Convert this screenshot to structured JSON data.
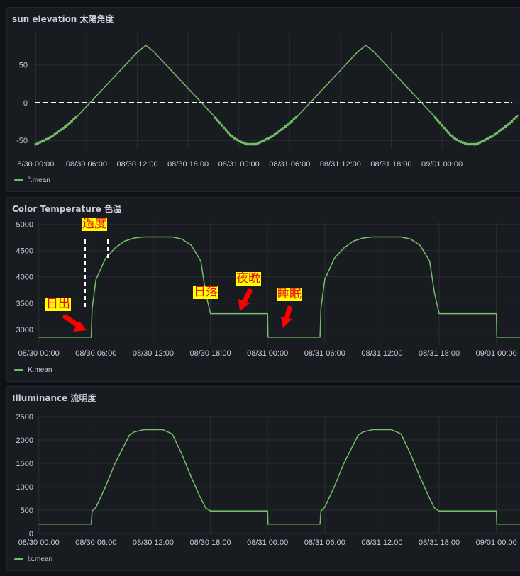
{
  "colors": {
    "line": "#73bf69",
    "grid": "#2a2d33",
    "text": "#ccccdc",
    "annotation_bg": "#ffff00",
    "annotation_text": "#e81010",
    "arrow": "#ff0000",
    "reference_line": "#ffffff"
  },
  "panels": {
    "sun": {
      "title": "sun elevation 太陽角度",
      "legend": "°.mean"
    },
    "ct": {
      "title": "Color Temperature 色温",
      "legend": "K.mean"
    },
    "lux": {
      "title": "Illuminance 流明度",
      "legend": "lx.mean"
    }
  },
  "annotations": {
    "transition": "過度",
    "sunrise": "日出",
    "sunset": "日落",
    "evening": "夜晩",
    "sleep": "睡眠"
  },
  "chart_data": [
    {
      "type": "line",
      "title": "sun elevation 太陽角度",
      "xlabel": "",
      "ylabel": "",
      "x_unit": "hours since 08/30 00:00",
      "xlim": [
        -0.2,
        57.3
      ],
      "x_tick_labels": [
        "8/30 00:00",
        "08/30 06:00",
        "08/30 12:00",
        "08/30 18:00",
        "08/31 00:00",
        "08/31 06:00",
        "08/31 12:00",
        "08/31 18:00",
        "09/01 00:00"
      ],
      "x_ticks": [
        0,
        6,
        12,
        18,
        24,
        30,
        36,
        42,
        48
      ],
      "ylim": [
        -62,
        92
      ],
      "y_ticks": [
        -50,
        0,
        50
      ],
      "grid": true,
      "legend": "bottom-left",
      "reference_line": {
        "y": 0,
        "style": "dashed"
      },
      "series": [
        {
          "name": "°.mean",
          "x": [
            0,
            1,
            2,
            3,
            4,
            5,
            6,
            7,
            8,
            9,
            10,
            11,
            12,
            13,
            14,
            15,
            16,
            17,
            18,
            19,
            20,
            21,
            22,
            23,
            24,
            25,
            26,
            27,
            28,
            29,
            30,
            31,
            32,
            33,
            34,
            35,
            36,
            37,
            38,
            39,
            40,
            41,
            42,
            43,
            44,
            45,
            46,
            47,
            48,
            49,
            50,
            51,
            52,
            53,
            54,
            55,
            56,
            57
          ],
          "y": [
            -55,
            -50,
            -44,
            -36,
            -27,
            -17,
            -5,
            7,
            19,
            31,
            43,
            55,
            67,
            76,
            67,
            55,
            43,
            31,
            19,
            7,
            -5,
            -17,
            -30,
            -43,
            -51,
            -55,
            -55,
            -50,
            -44,
            -36,
            -27,
            -17,
            -5,
            7,
            19,
            31,
            43,
            55,
            67,
            76,
            67,
            55,
            43,
            31,
            19,
            7,
            -5,
            -17,
            -30,
            -43,
            -51,
            -55,
            -55,
            -50,
            -44,
            -36,
            -27,
            -17
          ]
        }
      ]
    },
    {
      "type": "line",
      "title": "Color Temperature 色温",
      "xlabel": "",
      "ylabel": "",
      "x_unit": "hours since 08/30 00:00",
      "xlim": [
        -0.2,
        51.3
      ],
      "x_tick_labels": [
        "08/30 00:00",
        "08/30 06:00",
        "08/30 12:00",
        "08/30 18:00",
        "08/31 00:00",
        "08/31 06:00",
        "08/31 12:00",
        "08/31 18:00",
        "09/01 00:00"
      ],
      "x_ticks": [
        0,
        6,
        12,
        18,
        24,
        30,
        36,
        42,
        48
      ],
      "ylim": [
        2700,
        5050
      ],
      "y_ticks": [
        3000,
        3500,
        4000,
        4500,
        5000
      ],
      "grid": true,
      "legend": "bottom-left",
      "series": [
        {
          "name": "K.mean",
          "x": [
            0,
            5.5,
            5.6,
            6,
            7,
            8,
            9,
            10,
            11,
            12,
            13,
            14,
            15,
            16,
            17,
            17.5,
            18,
            19,
            24,
            24.05,
            29.5,
            29.6,
            30,
            31,
            32,
            33,
            34,
            35,
            36,
            37,
            38,
            39,
            40,
            41,
            41.5,
            42,
            43,
            48,
            48.05,
            51.3
          ],
          "y": [
            2850,
            2850,
            3400,
            3950,
            4350,
            4550,
            4680,
            4740,
            4760,
            4760,
            4760,
            4760,
            4720,
            4600,
            4300,
            3700,
            3300,
            3300,
            3300,
            2850,
            2850,
            3400,
            3950,
            4350,
            4550,
            4680,
            4740,
            4760,
            4760,
            4760,
            4760,
            4720,
            4600,
            4300,
            3700,
            3300,
            3300,
            3300,
            2850,
            2850
          ]
        }
      ]
    },
    {
      "type": "line",
      "title": "Illuminance 流明度",
      "xlabel": "",
      "ylabel": "",
      "x_unit": "hours since 08/30 00:00",
      "xlim": [
        -0.2,
        51.3
      ],
      "x_tick_labels": [
        "08/30 00:00",
        "08/30 06:00",
        "08/30 12:00",
        "08/30 18:00",
        "08/31 00:00",
        "08/31 06:00",
        "08/31 12:00",
        "08/31 18:00",
        "09/01 00:00"
      ],
      "x_ticks": [
        0,
        6,
        12,
        18,
        24,
        30,
        36,
        42,
        48
      ],
      "ylim": [
        0,
        2500
      ],
      "y_ticks": [
        0,
        500,
        1000,
        1500,
        2000,
        2500
      ],
      "grid": true,
      "legend": "bottom-left",
      "series": [
        {
          "name": "lx.mean",
          "x": [
            0,
            5.5,
            5.6,
            6,
            7,
            8,
            9,
            9.5,
            10,
            11,
            12,
            13,
            14,
            15,
            16,
            17,
            17.5,
            18,
            24,
            24.05,
            29.5,
            29.6,
            30,
            31,
            32,
            33,
            33.5,
            34,
            35,
            36,
            37,
            38,
            39,
            40,
            41,
            41.5,
            42,
            48,
            48.05,
            51.3
          ],
          "y": [
            200,
            200,
            480,
            560,
            1000,
            1500,
            1900,
            2100,
            2170,
            2220,
            2220,
            2220,
            2130,
            1700,
            1200,
            750,
            550,
            480,
            480,
            200,
            200,
            480,
            560,
            1000,
            1500,
            1900,
            2100,
            2170,
            2220,
            2220,
            2220,
            2130,
            1700,
            1200,
            750,
            550,
            480,
            480,
            200,
            200
          ]
        }
      ]
    }
  ]
}
